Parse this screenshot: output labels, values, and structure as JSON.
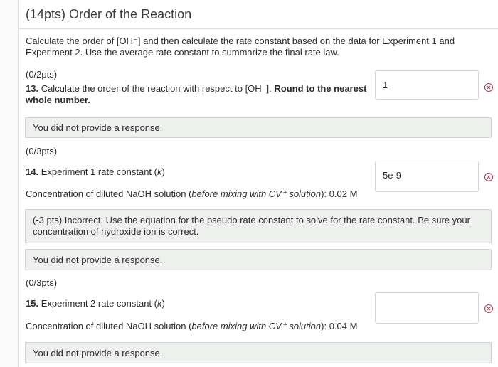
{
  "header": {
    "title": "(14pts) Order of the Reaction"
  },
  "intro": {
    "line1": "Calculate the order of [OH⁻] and then calculate the rate constant based on the data for Experiment 1 and",
    "line2": "Experiment 2. Use the average rate constant to summarize the final rate law."
  },
  "q13": {
    "points": "(0/2pts)",
    "number": "13.",
    "text": " Calculate the order of the reaction with respect to [OH⁻].",
    "bold_tail": "Round to the nearest",
    "bold_line2": "whole number.",
    "answer": "1",
    "feedback": "You did not provide a response."
  },
  "q14": {
    "points": "(0/3pts)",
    "number": "14.",
    "text": " Experiment 1 rate constant (",
    "k": "k",
    "text_end": ")",
    "conc_prefix": "Concentration of diluted NaOH solution (",
    "conc_italic": "before mixing with CV⁺ solution",
    "conc_suffix": "): 0.02 M",
    "answer": "5e-9",
    "feedback_line1": "(-3 pts) Incorrect. Use the equation for the pseudo rate constant to solve for the rate constant. Be sure your",
    "feedback_line2": "concentration of hydroxide ion is correct.",
    "feedback2": "You did not provide a response."
  },
  "q15": {
    "points": "(0/3pts)",
    "number": "15.",
    "text": " Experiment 2 rate constant (",
    "k": "k",
    "text_end": ")",
    "conc_prefix": "Concentration of diluted NaOH solution (",
    "conc_italic": "before mixing with CV⁺ solution",
    "conc_suffix": "): 0.04 M",
    "answer": "",
    "feedback": "You did not provide a response."
  },
  "icons": {
    "incorrect": "x-circle-icon",
    "incorrect_color": "#a8324a"
  }
}
